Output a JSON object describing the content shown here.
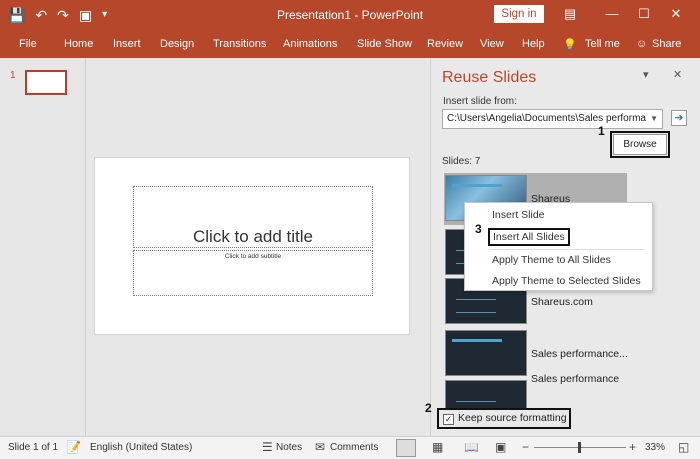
{
  "titlebar": {
    "title": "Presentation1  -  PowerPoint",
    "signin": "Sign in",
    "qat_icons": [
      "save-icon",
      "undo-icon",
      "redo-icon",
      "present-icon",
      "customize-icon"
    ],
    "window_icons": [
      "ribbon-display-icon",
      "minimize-icon",
      "maximize-icon",
      "close-icon"
    ]
  },
  "ribbon": {
    "tabs": [
      "File",
      "Home",
      "Insert",
      "Design",
      "Transitions",
      "Animations",
      "Slide Show",
      "Review",
      "View",
      "Help"
    ],
    "tell_me": "Tell me",
    "share": "Share"
  },
  "thumbnails": {
    "slide_number": "1"
  },
  "slide": {
    "title_placeholder": "Click to add title",
    "subtitle_placeholder": "Click to add subtitle"
  },
  "reuse_pane": {
    "title": "Reuse Slides",
    "insert_from_label": "Insert slide from:",
    "path_value": "C:\\Users\\Angelia\\Documents\\Sales performa",
    "browse_label": "Browse",
    "slides_count": "Slides: 7",
    "items": [
      {
        "label": "Shareus"
      },
      {
        "label": ""
      },
      {
        "label": "Shareus.com"
      },
      {
        "label": "Sales performance..."
      },
      {
        "label": "Sales performance"
      }
    ],
    "keep_formatting_label": "Keep source formatting",
    "keep_formatting_checked": true
  },
  "context_menu": {
    "items": [
      "Insert Slide",
      "Insert All Slides",
      "Apply Theme to All Slides",
      "Apply Theme to Selected Slides"
    ]
  },
  "callouts": [
    "1",
    "2",
    "3"
  ],
  "status": {
    "slide_info": "Slide 1 of 1",
    "language": "English (United States)",
    "notes": "Notes",
    "comments": "Comments",
    "zoom": "33%"
  },
  "colors": {
    "accent": "#b7472a",
    "pane_bg": "#e9e9e9"
  }
}
